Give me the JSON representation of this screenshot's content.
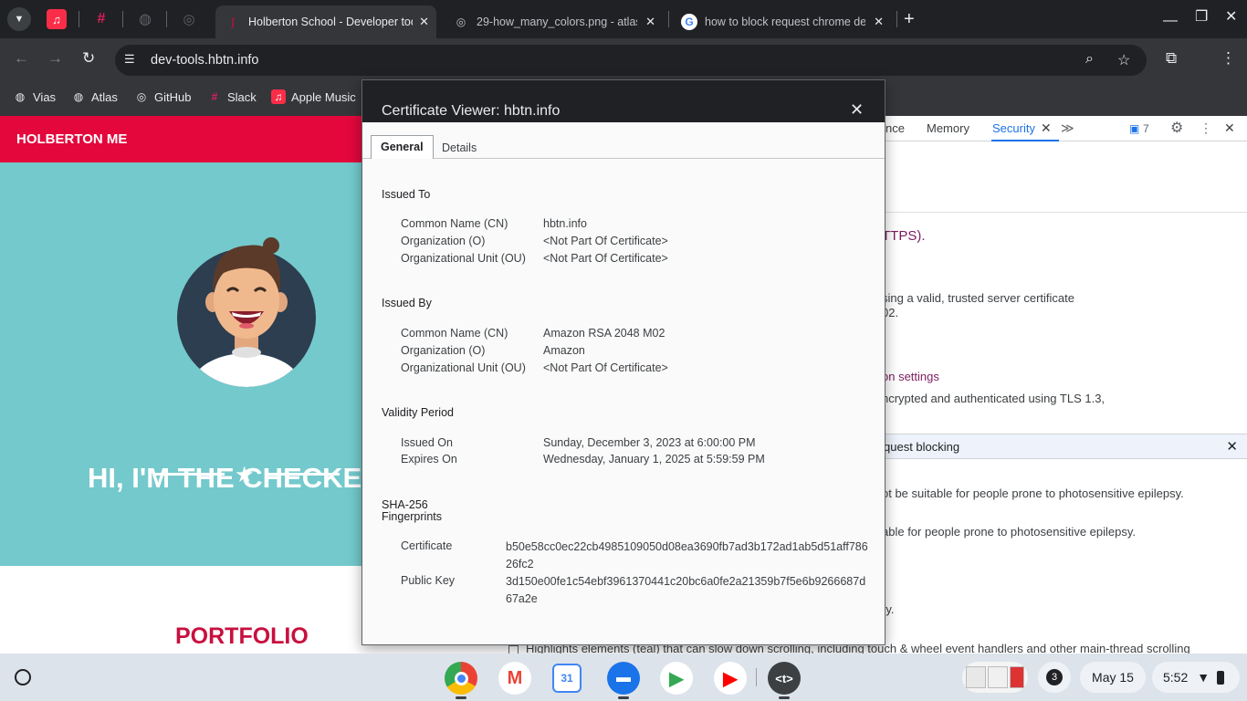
{
  "browser": {
    "pinned_tabs": [
      "apple-music-icon",
      "slack-icon",
      "globe-icon",
      "github-icon"
    ],
    "tabs": [
      {
        "title": "Holberton School - Developer tools",
        "active": true
      },
      {
        "title": "29-how_many_colors.png - atlas",
        "active": false
      },
      {
        "title": "how to block request chrome dev",
        "active": false
      }
    ],
    "new_tab": "+",
    "url": "dev-tools.hbtn.info",
    "bookmarks": [
      {
        "label": "Vias",
        "icon": "globe-icon"
      },
      {
        "label": "Atlas",
        "icon": "globe-icon"
      },
      {
        "label": "GitHub",
        "icon": "github-icon"
      },
      {
        "label": "Slack",
        "icon": "slack-icon"
      },
      {
        "label": "Apple Music",
        "icon": "apple-music-icon"
      }
    ]
  },
  "page": {
    "brand": "HOLBERTON ME",
    "hero_title": "HI, I'M THE CHECKER",
    "section_title": "PORTFOLIO"
  },
  "devtools": {
    "tabs": [
      "nce",
      "Memory",
      "Security"
    ],
    "issues_count": "7",
    "fragments": {
      "https": "TTPS).",
      "cert_line1": "sing a valid, trusted server certificate",
      "cert_line2": "02.",
      "connection_settings": "on settings",
      "tls": "ncrypted and authenticated using TLS 1.3,",
      "drawer_title": "quest blocking",
      "epilepsy1": "ot be suitable for people prone to photosensitive epilepsy.",
      "epilepsy2": "able for people prone to photosensitive epilepsy.",
      "ry": "ry.",
      "scrolling": "Highlights elements (teal) that can slow down scrolling, including touch & wheel event handlers and other main-thread scrolling"
    }
  },
  "certificate": {
    "title": "Certificate Viewer: hbtn.info",
    "tabs": {
      "general": "General",
      "details": "Details"
    },
    "issued_to": {
      "heading": "Issued To",
      "cn_label": "Common Name (CN)",
      "cn": "hbtn.info",
      "o_label": "Organization (O)",
      "o": "<Not Part Of Certificate>",
      "ou_label": "Organizational Unit (OU)",
      "ou": "<Not Part Of Certificate>"
    },
    "issued_by": {
      "heading": "Issued By",
      "cn_label": "Common Name (CN)",
      "cn": "Amazon RSA 2048 M02",
      "o_label": "Organization (O)",
      "o": "Amazon",
      "ou_label": "Organizational Unit (OU)",
      "ou": "<Not Part Of Certificate>"
    },
    "validity": {
      "heading": "Validity Period",
      "issued_label": "Issued On",
      "issued": "Sunday, December 3, 2023 at 6:00:00 PM",
      "expires_label": "Expires On",
      "expires": "Wednesday, January 1, 2025 at 5:59:59 PM"
    },
    "fingerprints": {
      "heading_line1": "SHA-256",
      "heading_line2": "Fingerprints",
      "cert_label": "Certificate",
      "cert": "b50e58cc0ec22cb4985109050d08ea3690fb7ad3b172ad1ab5d51aff78626fc2",
      "key_label": "Public Key",
      "key": "3d150e00fe1c54ebf3961370441c20bc6a0fe2a21359b7f5e6b9266687d67a2e"
    }
  },
  "shelf": {
    "apps": [
      "chrome-icon",
      "gmail-icon",
      "calendar-icon",
      "files-icon",
      "play-store-icon",
      "youtube-icon",
      "terminal-icon"
    ],
    "calendar_day": "31",
    "notifications": "3",
    "date": "May 15",
    "time": "5:52"
  },
  "colors": {
    "brand_red": "#e3073c",
    "hero_teal": "#74c9cc",
    "devtools_accent": "#1a73e8",
    "chrome_dark": "#202124"
  }
}
